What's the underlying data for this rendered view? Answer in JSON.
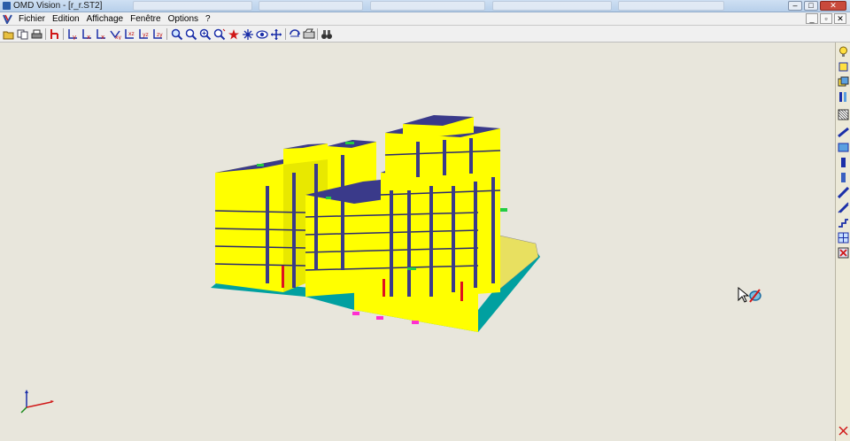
{
  "window": {
    "title": "OMD Vision - [r_r.ST2]"
  },
  "menu": {
    "items": [
      "Fichier",
      "Edition",
      "Affichage",
      "Fenêtre",
      "Options",
      "?"
    ]
  },
  "window_controls": {
    "minimize": "_",
    "restore": "▫",
    "close": "✕"
  },
  "toolbar": {
    "buttons": [
      "open-folder-icon",
      "copy-icon",
      "print-icon",
      "red-fork-icon",
      "axis-y-icon",
      "axis-x-icon",
      "axis-x2-icon",
      "axis-xy-icon",
      "axis-z-icon",
      "axis-xz-icon",
      "axis-yz-icon",
      "zoom-window-icon",
      "zoom-extents-icon",
      "zoom-in-icon",
      "zoom-dynamic-icon",
      "select-star-icon",
      "fit-icon",
      "eye-icon",
      "pan-icon",
      "rotate-icon",
      "render-icon",
      "binoculars-icon"
    ]
  },
  "colors": {
    "building_face": "#ffff00",
    "building_top": "#3a3a8a",
    "slab_edge": "#00a0a0",
    "accent_green": "#22cc44",
    "column_red": "#e01020",
    "magenta": "#ff30d0"
  }
}
